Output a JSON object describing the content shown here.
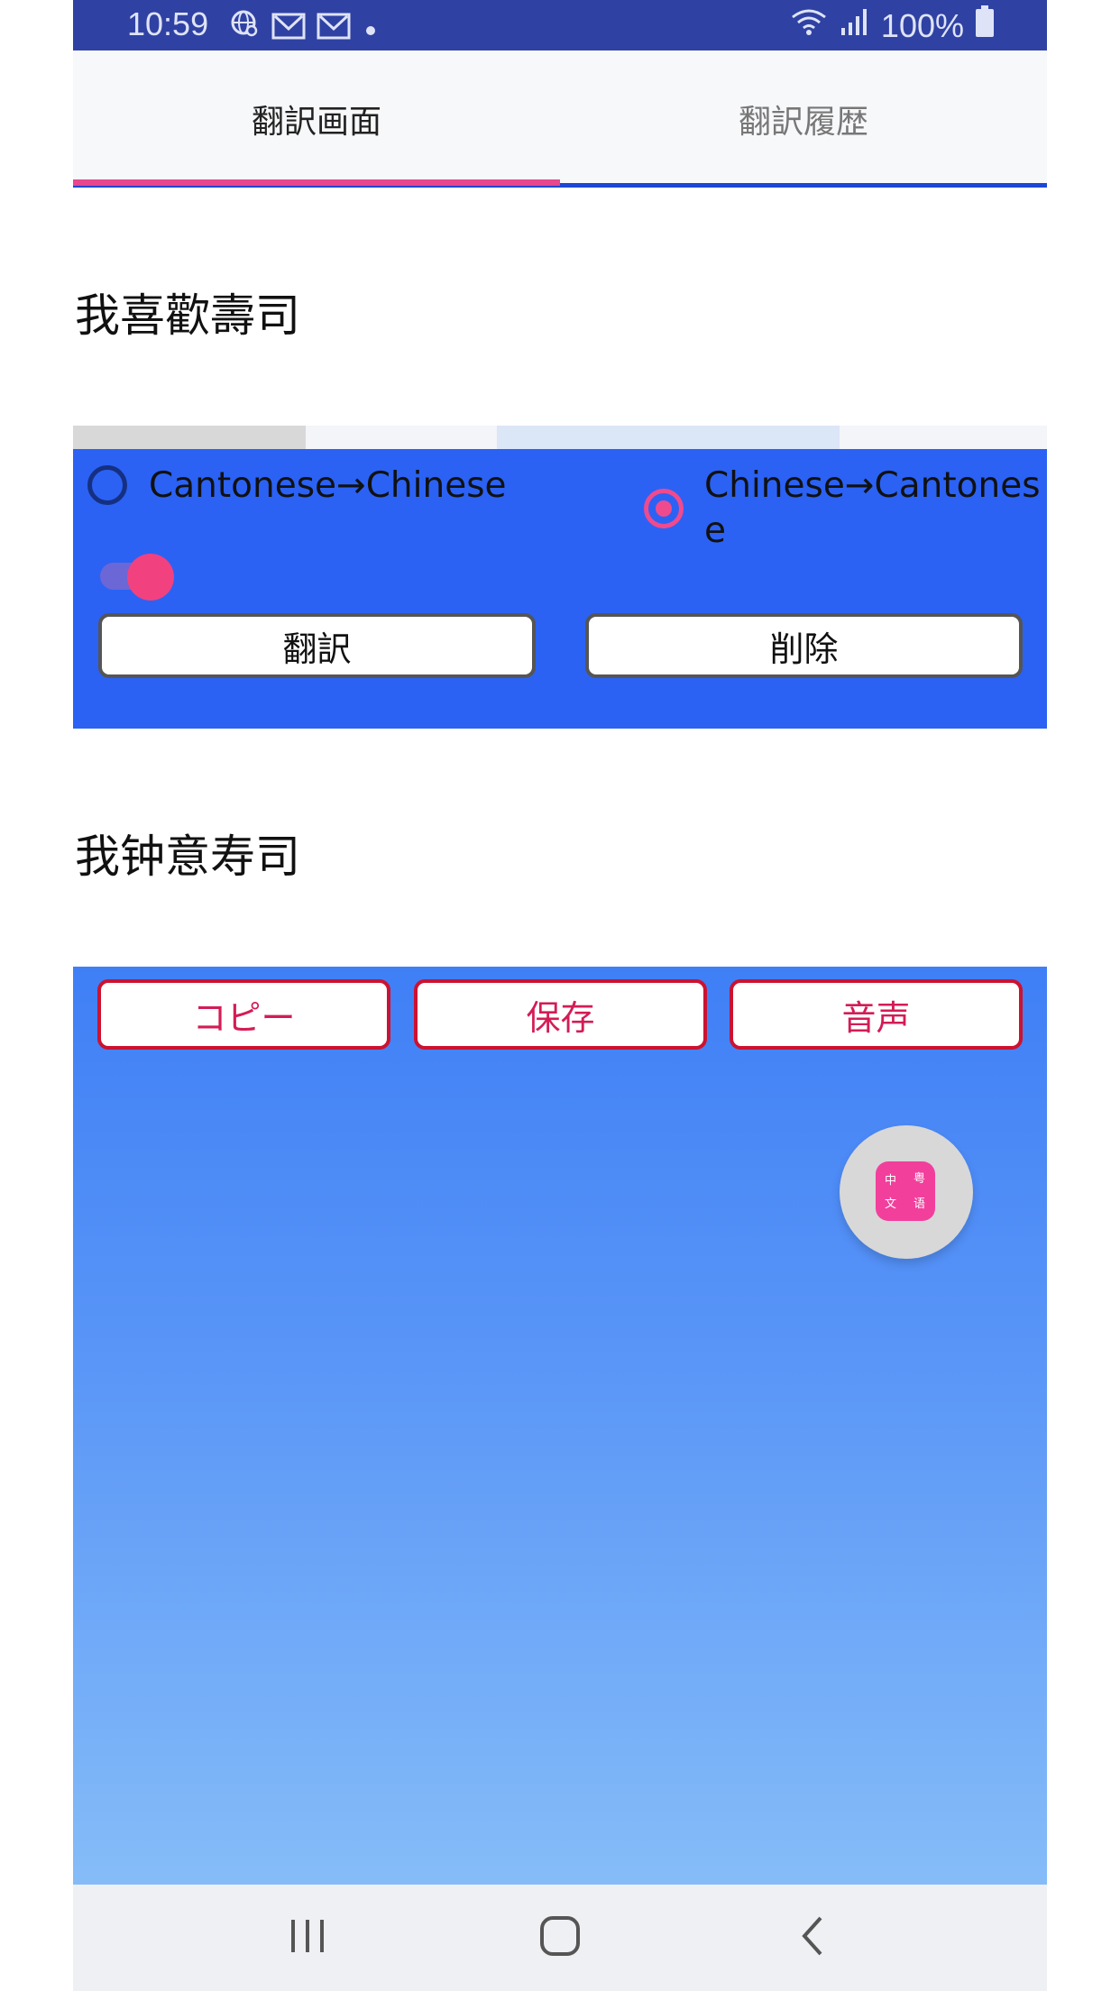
{
  "status_bar": {
    "time": "10:59",
    "battery": "100%",
    "left_icons": [
      "globe-search-icon",
      "gmail-icon",
      "gmail-icon",
      "dot-icon"
    ],
    "right_icons": [
      "wifi-icon",
      "signal-icon",
      "battery-icon"
    ]
  },
  "tabs": [
    {
      "label": "翻訳画面",
      "active": true
    },
    {
      "label": "翻訳履歴",
      "active": false
    }
  ],
  "input_text": "我喜歡壽司",
  "controls": {
    "radio_canto_to_chinese": "Cantonese→Chinese",
    "radio_chinese_to_canto": "Chinese→Cantonese",
    "selected": "Chinese→Cantonese",
    "toggle_on": true,
    "translate_button": "翻訳",
    "delete_button": "削除"
  },
  "output_text": "我钟意寿司",
  "output_actions": {
    "copy": "コピー",
    "save": "保存",
    "voice": "音声"
  },
  "fab": {
    "icon": "app-logo-icon",
    "chars": [
      "中",
      "粤",
      "文",
      "语"
    ]
  },
  "nav_bar": {
    "icons": [
      "recents-icon",
      "home-icon",
      "back-icon"
    ]
  },
  "colors": {
    "status_bar": "#2f42a3",
    "accent_pink": "#f04a8e",
    "panel_blue": "#2b62f4",
    "tab_underline": "#1c47d6"
  }
}
